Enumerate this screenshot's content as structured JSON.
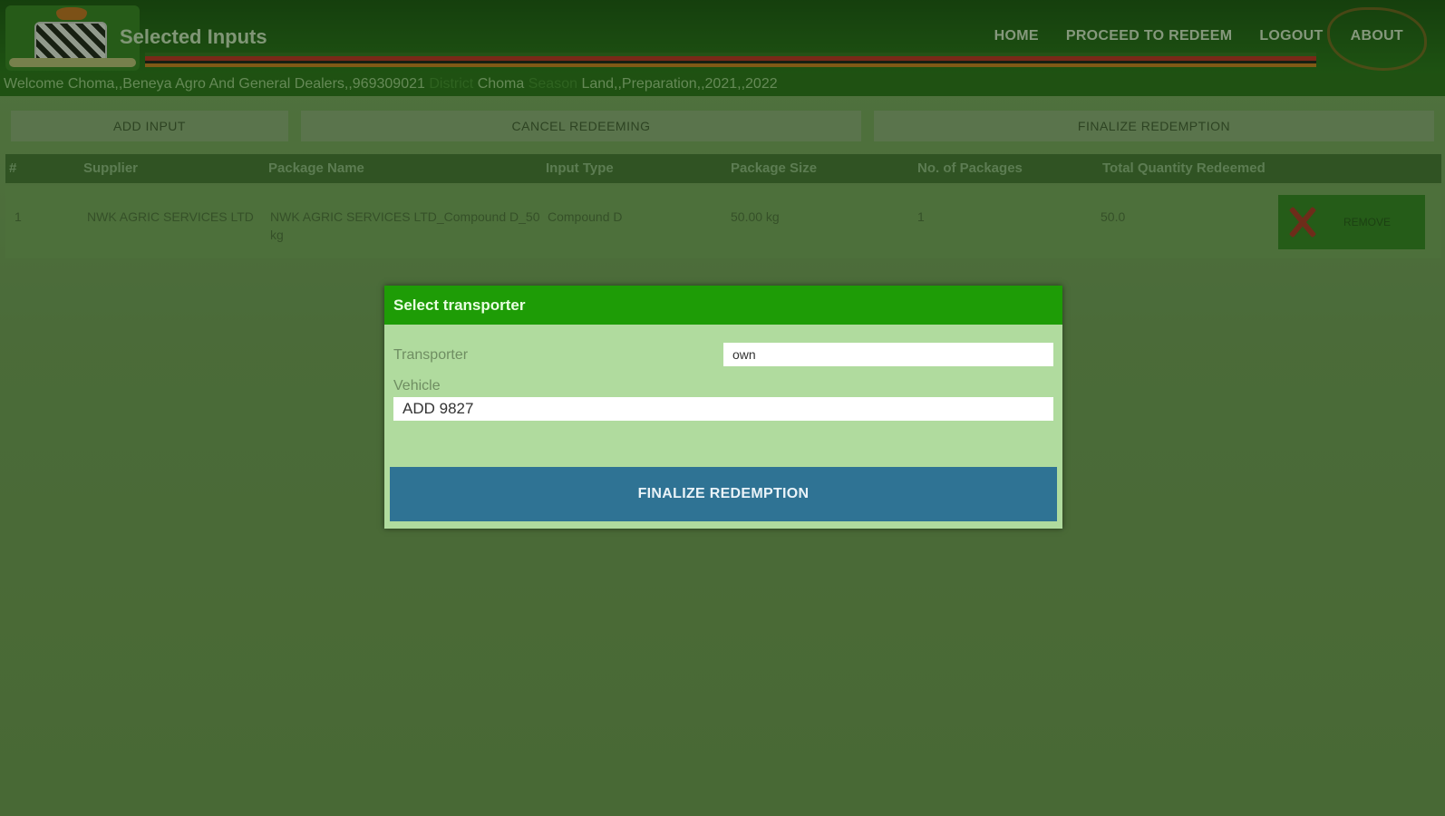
{
  "header": {
    "title": "Selected Inputs",
    "nav": [
      "HOME",
      "PROCEED TO REDEEM",
      "LOGOUT",
      "ABOUT"
    ]
  },
  "welcome": {
    "text": "Welcome Choma,,Beneya Agro And General Dealers,,969309021",
    "district_label": "District",
    "district_value": "Choma",
    "season_label": "Season",
    "season_value": "Land,,Preparation,,2021,,2022"
  },
  "actions": {
    "add_input": "ADD INPUT",
    "cancel": "CANCEL REDEEMING",
    "finalize": "FINALIZE REDEMPTION"
  },
  "table": {
    "headers": [
      "#",
      "Supplier",
      "Package Name",
      "Input Type",
      "Package Size",
      "No. of Packages",
      "Total Quantity Redeemed"
    ],
    "rows": [
      {
        "num": "1",
        "supplier": "NWK AGRIC SERVICES LTD",
        "package_name": "NWK AGRIC SERVICES LTD_Compound D_50 kg",
        "input_type": "Compound D",
        "package_size": "50.00 kg",
        "packages": "1",
        "total": "50.0",
        "remove_label": "REMOVE"
      }
    ]
  },
  "dialog": {
    "title": "Select transporter",
    "transporter_label": "Transporter",
    "transporter_value": "own",
    "vehicle_label": "Vehicle",
    "vehicle_value": "ADD 9827",
    "finalize_label": "FINALIZE REDEMPTION"
  },
  "colors": {
    "header_green": "#1f6b12",
    "dialog_title": "#1e9c06",
    "finalize_blue": "#2f7394",
    "remove_red": "#b0271f"
  },
  "icons": [
    "coat-of-arms-logo",
    "close-icon",
    "zambia-map-outline"
  ]
}
